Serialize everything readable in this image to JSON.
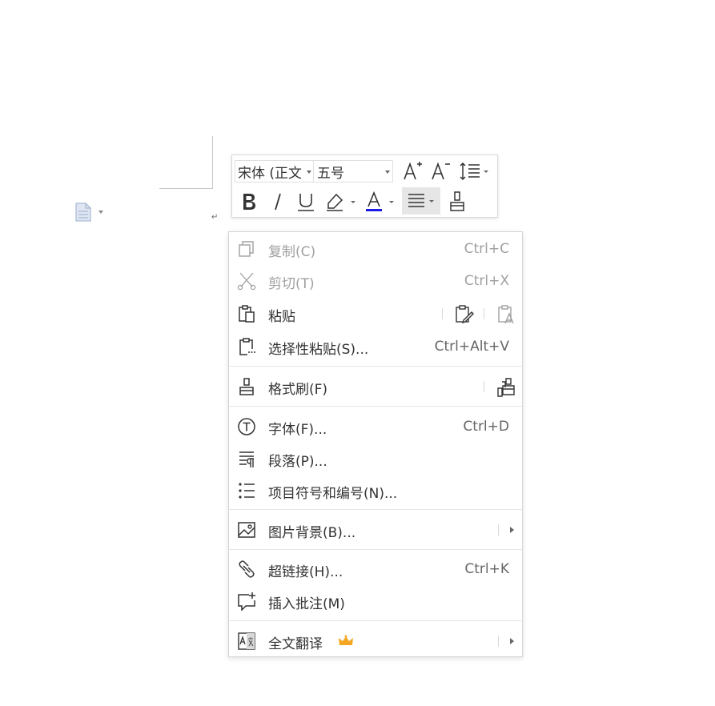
{
  "toolbar": {
    "font_name": "宋体 (正文",
    "font_size": "五号",
    "underline_color": "#1a1ae6",
    "align_highlight": "#e6e6e6"
  },
  "menu": {
    "copy": {
      "label": "复制(C)",
      "shortcut": "Ctrl+C"
    },
    "cut": {
      "label": "剪切(T)",
      "shortcut": "Ctrl+X"
    },
    "paste": {
      "label": "粘贴"
    },
    "paste_special": {
      "label": "选择性粘贴(S)...",
      "shortcut": "Ctrl+Alt+V"
    },
    "format_painter": {
      "label": "格式刷(F)"
    },
    "font": {
      "label": "字体(F)...",
      "shortcut": "Ctrl+D"
    },
    "paragraph": {
      "label": "段落(P)..."
    },
    "bullets": {
      "label": "项目符号和编号(N)..."
    },
    "picture_bg": {
      "label": "图片背景(B)..."
    },
    "hyperlink": {
      "label": "超链接(H)...",
      "shortcut": "Ctrl+K"
    },
    "comment": {
      "label": "插入批注(M)"
    },
    "translate": {
      "label": "全文翻译"
    }
  },
  "colors": {
    "crown": "#f5a623",
    "disabled": "#a0a0a0",
    "icon": "#555555"
  }
}
